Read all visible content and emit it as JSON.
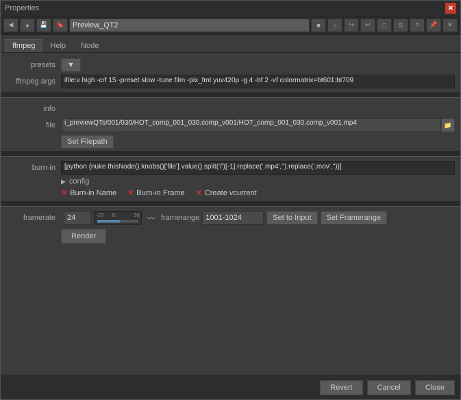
{
  "window": {
    "title": "Properties"
  },
  "toolbar": {
    "node_name": "Preview_QT2",
    "icons": [
      "◀",
      "●",
      "💾",
      "🔖"
    ]
  },
  "tabs": [
    {
      "label": "ffmpeg",
      "active": true
    },
    {
      "label": "Help",
      "active": false
    },
    {
      "label": "Node",
      "active": false
    }
  ],
  "form": {
    "presets_label": "presets",
    "presets_btn": "",
    "ffmpeg_args_label": "ffmpeg args",
    "ffmpeg_args_value": "ifile:v high -crf 15 -preset slow -tune film -pix_fmt yuv420p -g 4 -bf 2 -vf colormatrix=bt601:bt709",
    "info_label": "info",
    "file_label": "file",
    "file_value": "i_previewQTs/001/030/HOT_comp_001_030.comp_v001/HOT_comp_001_030.comp_v001.mp4",
    "set_filepath_btn": "Set Filepath",
    "burn_in_label": "burn-in",
    "burn_in_value": "[python {nuke.thisNode().knobs()['file'].value().split('/')[-1].replace('.mp4','').replace('.mov','')}]",
    "config_label": "config",
    "checkboxes": [
      {
        "label": "Burn-in Name",
        "checked": true
      },
      {
        "label": "Burn-in Frame",
        "checked": true
      },
      {
        "label": "Create vcurrent",
        "checked": true
      }
    ],
    "framerate_label": "framerate",
    "framerate_value": "24",
    "framerange_label": "framerange",
    "framerange_value": "1001-1024",
    "set_to_input_btn": "Set to Input",
    "set_framerange_btn": "Set Framerange",
    "render_btn": "Render"
  },
  "bottom": {
    "revert_btn": "Revert",
    "cancel_btn": "Cancel",
    "close_btn": "Close"
  }
}
